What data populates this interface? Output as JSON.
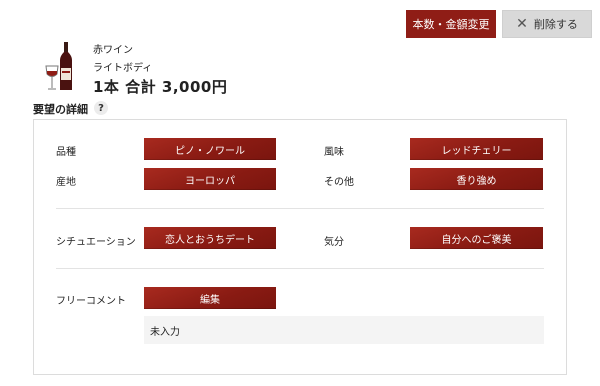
{
  "toolbar": {
    "change_label": "本数・金額変更",
    "delete_label": "削除する",
    "delete_icon": "close-icon"
  },
  "product": {
    "type": "赤ワイン",
    "body": "ライトボディ",
    "total": "1本 合計 3,000円",
    "icon": "wine-bottle-glass-icon"
  },
  "details": {
    "title": "要望の詳細",
    "help": "?",
    "variety_label": "品種",
    "variety_value": "ピノ・ノワール",
    "flavor_label": "風味",
    "flavor_value": "レッドチェリー",
    "origin_label": "産地",
    "origin_value": "ヨーロッパ",
    "other_label": "その他",
    "other_value": "香り強め",
    "situation_label": "シチュエーション",
    "situation_value": "恋人とおうちデート",
    "mood_label": "気分",
    "mood_value": "自分へのご褒美",
    "comment_label": "フリーコメント",
    "edit_label": "編集",
    "comment_text": "未入力"
  },
  "colors": {
    "accent": "#8f1d16",
    "delete_bg": "#d9d9d9"
  }
}
